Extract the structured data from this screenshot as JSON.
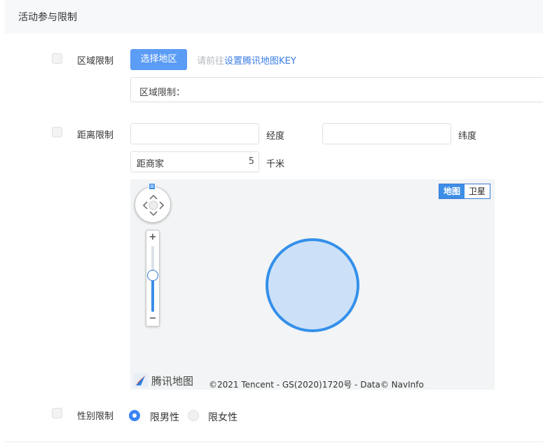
{
  "section": {
    "title": "活动参与限制"
  },
  "region": {
    "label": "区域限制",
    "checked": false,
    "select_button": "选择地区",
    "hint_prefix": "请前往",
    "hint_link": "设置腾讯地图KEY",
    "field_label": "区域限制："
  },
  "distance": {
    "label": "距离限制",
    "checked": false,
    "longitude_value": "",
    "longitude_unit": "经度",
    "latitude_value": "",
    "latitude_unit": "纬度",
    "distance_prefix": "距商家",
    "distance_value": "5",
    "distance_unit": "千米"
  },
  "map": {
    "type_map": "地图",
    "type_satellite": "卫星",
    "active_type": "地图",
    "logo_text": "腾讯地图",
    "copyright": "©2021 Tencent - GS(2020)1720号 - Data© NavInfo",
    "zoom_in": "+",
    "zoom_out": "−",
    "zoom_level_fraction": 0.55,
    "accent_color": "#3490ea"
  },
  "gender": {
    "label": "性别限制",
    "checked": false,
    "options": [
      "限男性",
      "限女性"
    ],
    "selected": "限男性"
  }
}
